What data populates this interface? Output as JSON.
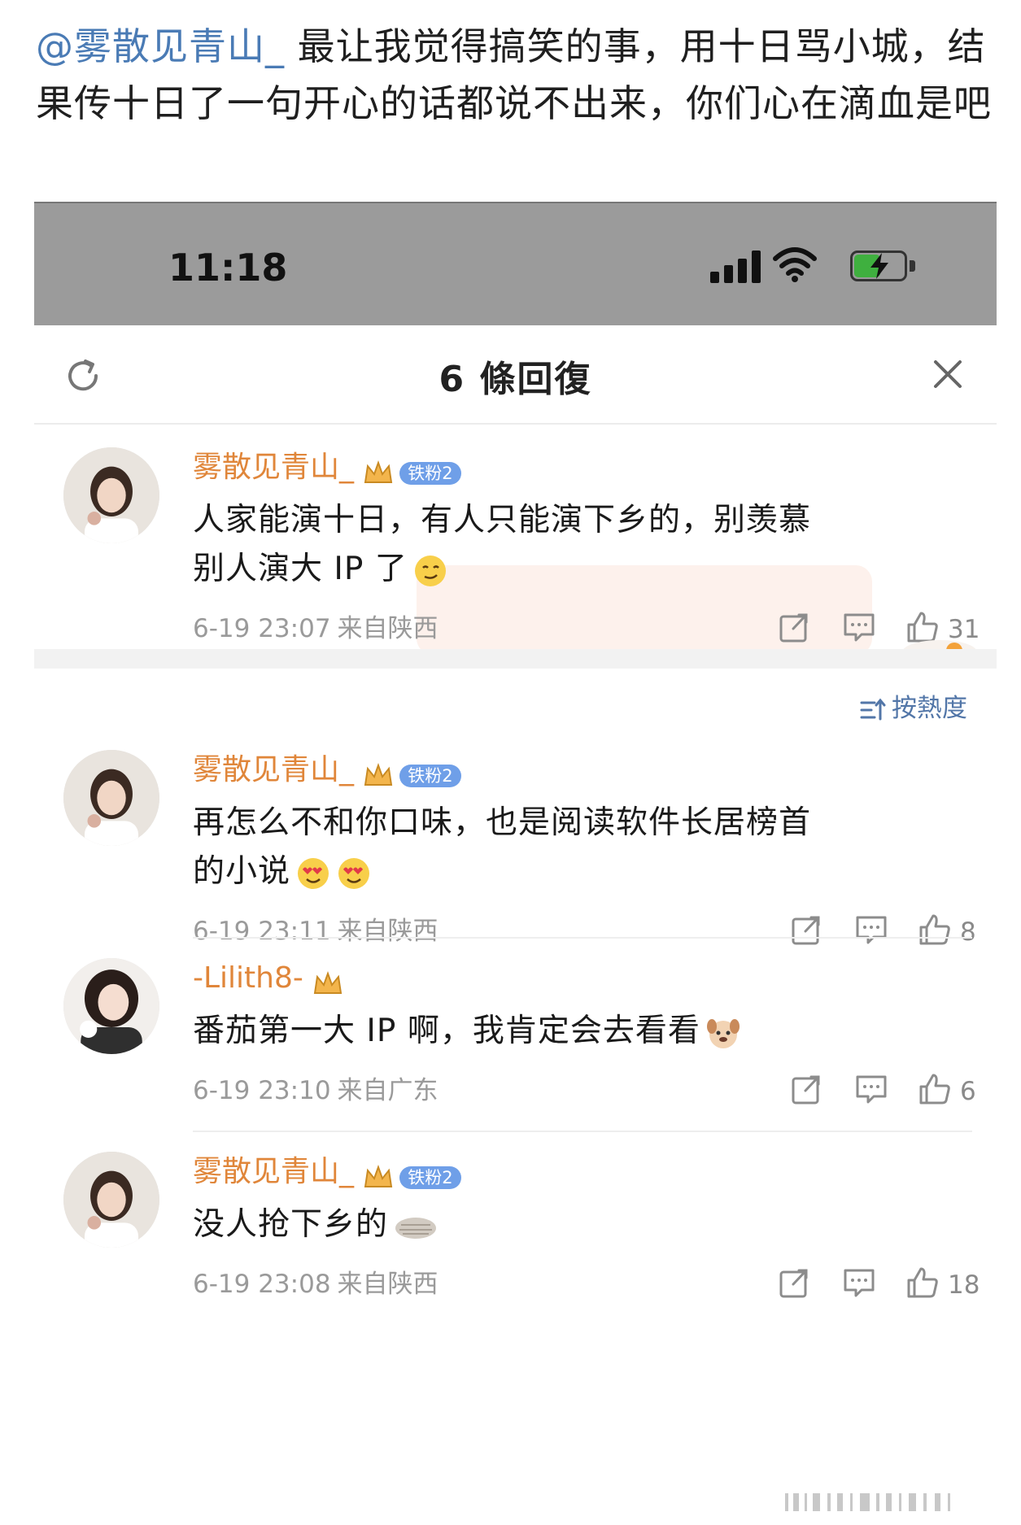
{
  "post": {
    "mention": "@雾散见青山_",
    "text": " 最让我觉得搞笑的事，用十日骂小城，结果传十日了一句开心的话都说不出来，你们心在滴血是吧"
  },
  "status_bar": {
    "time": "11:18",
    "battery_level": 0.55,
    "colors": {
      "bar": "#9b9b9b",
      "battery": "#3fb03f"
    }
  },
  "sheet": {
    "title": "6 條回復",
    "refresh_icon": "refresh-icon",
    "close_icon": "close-icon"
  },
  "sort": {
    "label": "按熱度"
  },
  "root_comment": {
    "username": "雾散见青山_",
    "fan_badge": "铁粉2",
    "text": "人家能演十日，有人只能演下乡的，别羡慕别人演大 IP 了",
    "emoji": "smirk-emoji",
    "time": "6-19 23:07",
    "location": "来自陕西",
    "likes": "31"
  },
  "replies": [
    {
      "username": "雾散见青山_",
      "fan_badge": "铁粉2",
      "text": "再怎么不和你口味，也是阅读软件长居榜首的小说",
      "emoji": "heart-eyes-emoji",
      "time": "6-19 23:11",
      "location": "来自陕西",
      "likes": "8"
    },
    {
      "username": "-Lilith8-",
      "fan_badge": "",
      "text": "番茄第一大 IP 啊，我肯定会去看看",
      "emoji": "dog-emoji",
      "time": "6-19 23:10",
      "location": "来自广东",
      "likes": "6"
    },
    {
      "username": "雾散见青山_",
      "fan_badge": "铁粉2",
      "text": "没人抢下乡的",
      "emoji": "pancake-emoji",
      "time": "6-19 23:08",
      "location": "来自陕西",
      "likes": "18"
    }
  ],
  "colors": {
    "username": "#e0863a",
    "mention": "#4a7bb5",
    "fan_badge": "#6f9fe8",
    "meta": "#9a9a9a",
    "sort": "#5276a8"
  }
}
